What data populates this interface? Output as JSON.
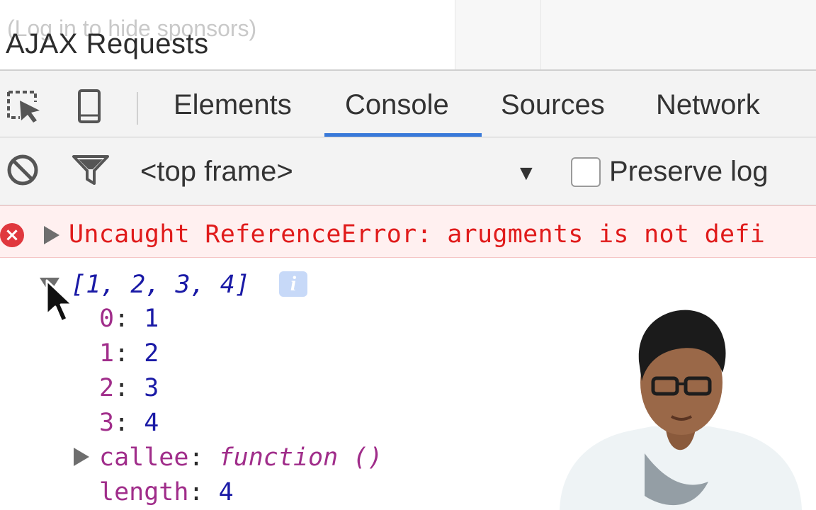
{
  "page": {
    "sponsor_text": "(Log in to hide sponsors)",
    "title": "AJAX Requests"
  },
  "devtools": {
    "tools": [
      {
        "name": "inspect-element-icon"
      },
      {
        "name": "device-toolbar-icon"
      }
    ],
    "tabs": [
      {
        "label": "Elements",
        "active": false
      },
      {
        "label": "Console",
        "active": true
      },
      {
        "label": "Sources",
        "active": false
      },
      {
        "label": "Network",
        "active": false
      }
    ],
    "accent_color": "#3879d9"
  },
  "console_toolbar": {
    "clear_icon": "clear-console-icon",
    "filter_icon": "filter-icon",
    "context": "<top frame>",
    "preserve_log": {
      "label": "Preserve log",
      "checked": false
    }
  },
  "console": {
    "error": {
      "icon": "error-icon",
      "text": "Uncaught ReferenceError: arugments is not defi"
    },
    "array_summary": "[1, 2, 3, 4]",
    "info_badge": "i",
    "props": [
      {
        "key": "0",
        "value": "1"
      },
      {
        "key": "1",
        "value": "2"
      },
      {
        "key": "2",
        "value": "3"
      },
      {
        "key": "3",
        "value": "4"
      }
    ],
    "callee": {
      "key": "callee",
      "value": "function ()"
    },
    "length": {
      "key": "length",
      "value": "4"
    },
    "error_color": "#e01b1b"
  }
}
